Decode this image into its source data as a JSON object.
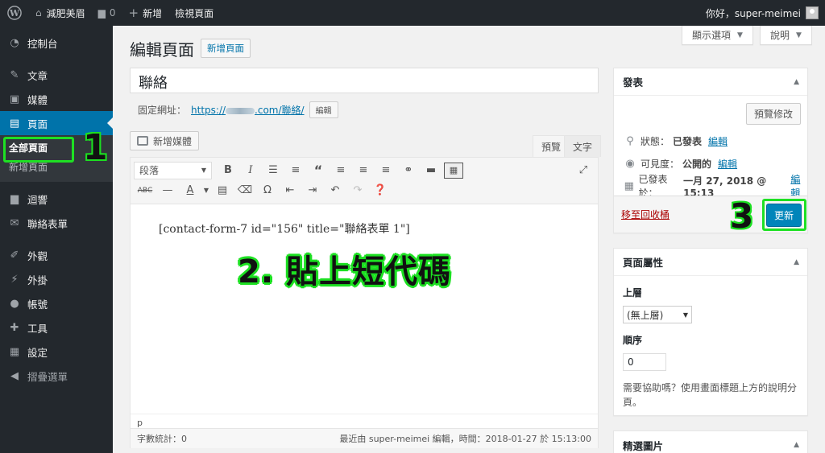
{
  "adminbar": {
    "site_name": "減肥美眉",
    "comments_count": "0",
    "new_label": "新增",
    "view_page": "檢視頁面",
    "greeting": "你好，super-meimei"
  },
  "sidebar": {
    "dashboard": "控制台",
    "posts": "文章",
    "media": "媒體",
    "pages": "頁面",
    "all_pages": "全部頁面",
    "add_new_page": "新增頁面",
    "comments": "迴響",
    "contact_forms": "聯絡表單",
    "appearance": "外觀",
    "plugins": "外掛",
    "users": "帳號",
    "tools": "工具",
    "settings": "設定",
    "collapse": "摺疊選單"
  },
  "screen_meta": {
    "screen_options": "顯示選項",
    "help": "說明"
  },
  "main": {
    "heading": "編輯頁面",
    "add_new": "新增頁面",
    "title_value": "聯絡",
    "permalink_label": "固定網址：",
    "permalink_prefix": "https://",
    "permalink_suffix": ".com/聯絡/",
    "permalink_edit": "編輯",
    "add_media": "新增媒體",
    "tab_visual": "預覽",
    "tab_text": "文字",
    "format_select": "段落",
    "content": "[contact-form-7 id=\"156\" title=\"聯絡表單 1\"]",
    "path": "p",
    "word_count": "字數統計：0",
    "last_edited": "最近由 super-meimei 編輯，時間：2018-01-27 於 15:13:00"
  },
  "annotations": {
    "step1": "1",
    "step2": "2. 貼上短代碼",
    "step3": "3",
    "highlight_color": "#1ee023"
  },
  "publish": {
    "title": "發表",
    "preview_button": "預覽修改",
    "status_label": "狀態：",
    "status_value": "已發表",
    "status_edit": "編輯",
    "visibility_label": "可見度：",
    "visibility_value": "公開的",
    "visibility_edit": "編輯",
    "published_label": "已發表於：",
    "published_value": "一月 27, 2018 @ 15:13",
    "published_edit": "編輯",
    "trash": "移至回收桶",
    "update": "更新"
  },
  "page_attributes": {
    "title": "頁面屬性",
    "parent_label": "上層",
    "parent_value": "(無上層)",
    "order_label": "順序",
    "order_value": "0",
    "help_text": "需要協助嗎？使用畫面標題上方的說明分頁。"
  },
  "featured_image": {
    "title": "精選圖片"
  },
  "colors": {
    "admin_dark": "#23282d",
    "accent_blue": "#0073aa",
    "button_primary": "#0085ba",
    "trash_red": "#a00"
  }
}
